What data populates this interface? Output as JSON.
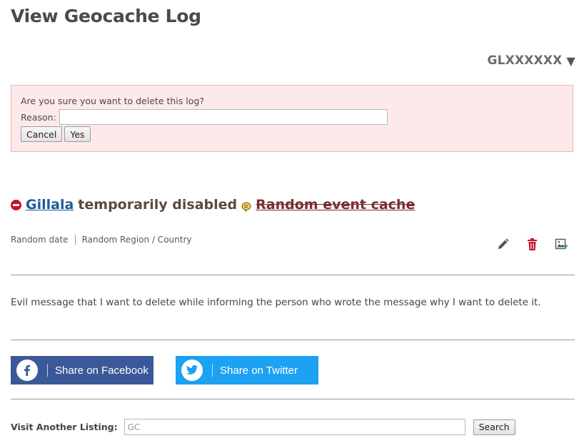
{
  "page": {
    "title": "View Geocache Log"
  },
  "cache_code": {
    "label": "GLXXXXXX",
    "caret": "▼"
  },
  "confirm": {
    "question": "Are you sure you want to delete this log?",
    "reason_label": "Reason:",
    "reason_value": "",
    "cancel_label": "Cancel",
    "yes_label": "Yes"
  },
  "log": {
    "user": "Gillala",
    "type": "temporarily disabled",
    "cache_name": "Random event cache",
    "date": "Random date",
    "region": "Random Region / Country",
    "text": "Evil message that I want to delete while informing the person who wrote the message why I want to delete it."
  },
  "icons": {
    "status": "no-entry-icon",
    "cache_type": "event-cache-icon",
    "edit": "pencil-icon",
    "delete": "trash-icon",
    "image": "add-image-icon"
  },
  "share": {
    "facebook_label": "Share on Facebook",
    "twitter_label": "Share on Twitter"
  },
  "visit": {
    "label": "Visit Another Listing:",
    "placeholder": "GC",
    "search_label": "Search"
  },
  "colors": {
    "facebook": "#3b5998",
    "twitter": "#1da1f2",
    "confirm_bg": "#fde9e9",
    "delete_red": "#c8102e",
    "link_blue": "#1d5b9a",
    "cache_link": "#7a2e2e"
  }
}
